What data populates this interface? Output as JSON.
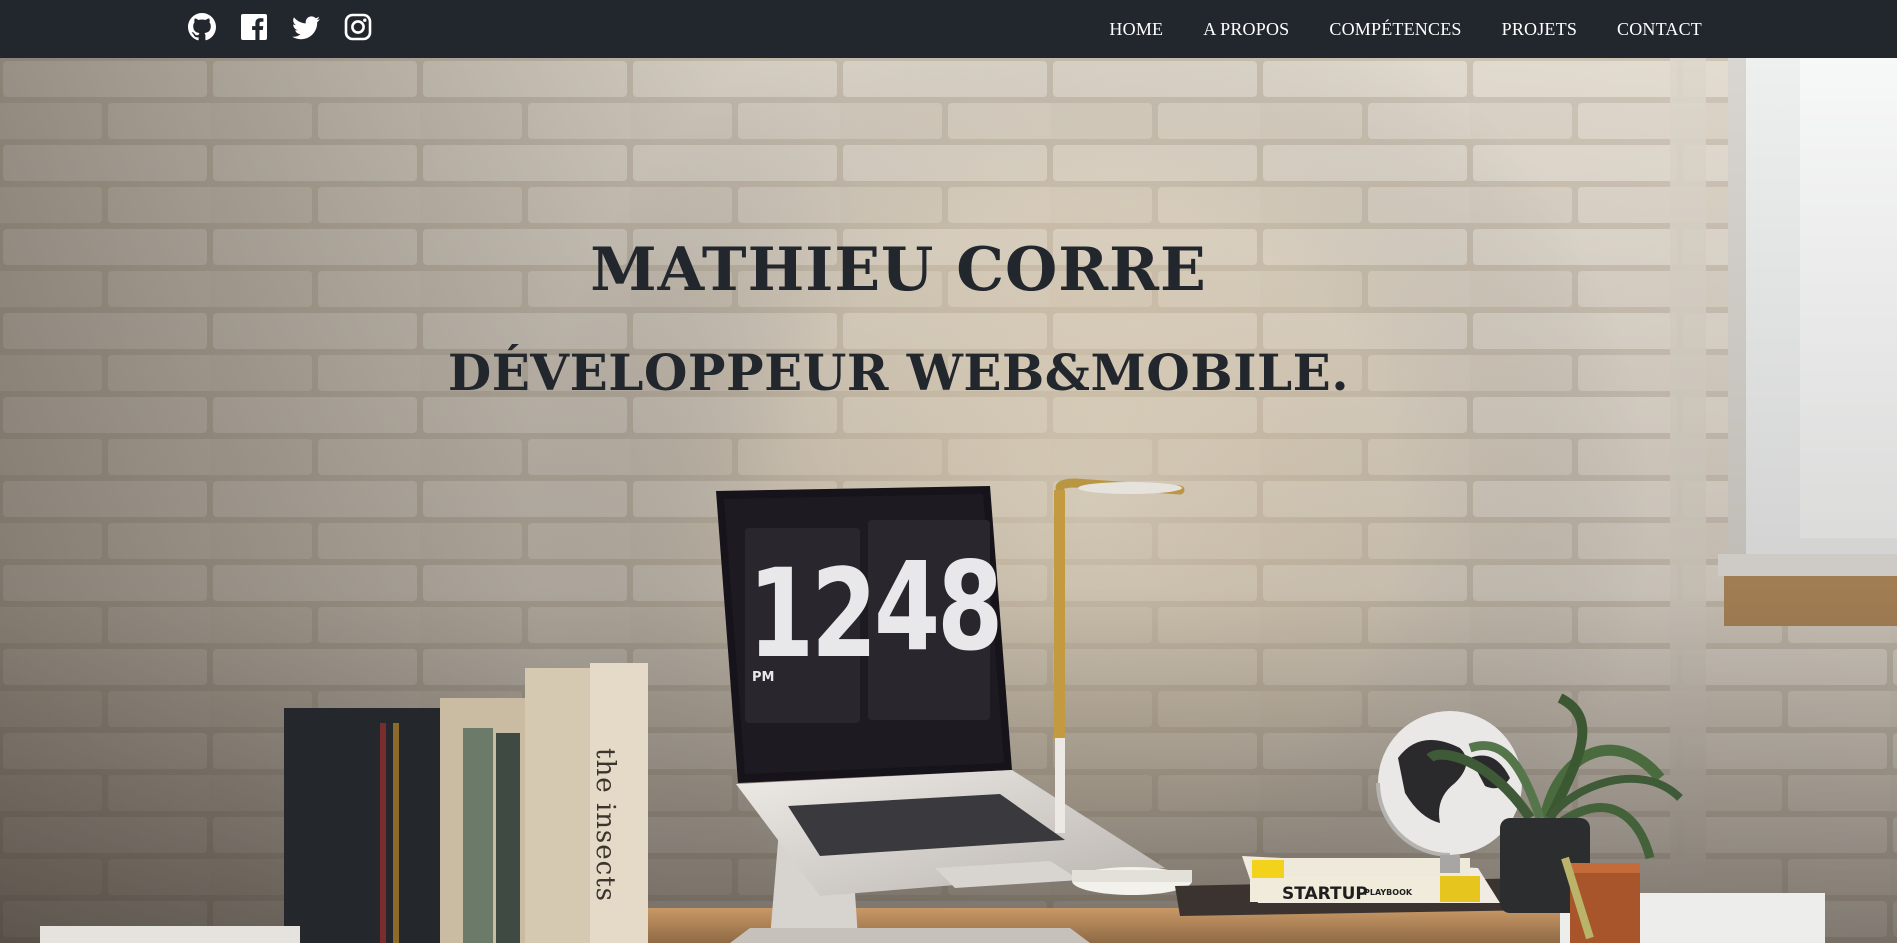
{
  "navbar": {
    "social": [
      {
        "name": "github-icon"
      },
      {
        "name": "facebook-icon"
      },
      {
        "name": "twitter-icon"
      },
      {
        "name": "instagram-icon"
      }
    ],
    "links": [
      "HOME",
      "A PROPOS",
      "COMPÉTENCES",
      "PROJETS",
      "CONTACT"
    ]
  },
  "hero": {
    "name": "MATHIEU CORRE",
    "title": "DÉVELOPPEUR WEB&MOBILE.",
    "clock": {
      "hours": "12",
      "minutes": "48",
      "period": "PM"
    },
    "book_spine": "the insects",
    "book_cover": {
      "title": "STARTUP",
      "subtitle": "PLAYBOOK"
    }
  },
  "colors": {
    "navbar": "#22262d",
    "heading": "#22262d",
    "nav_text": "#ffffff"
  }
}
